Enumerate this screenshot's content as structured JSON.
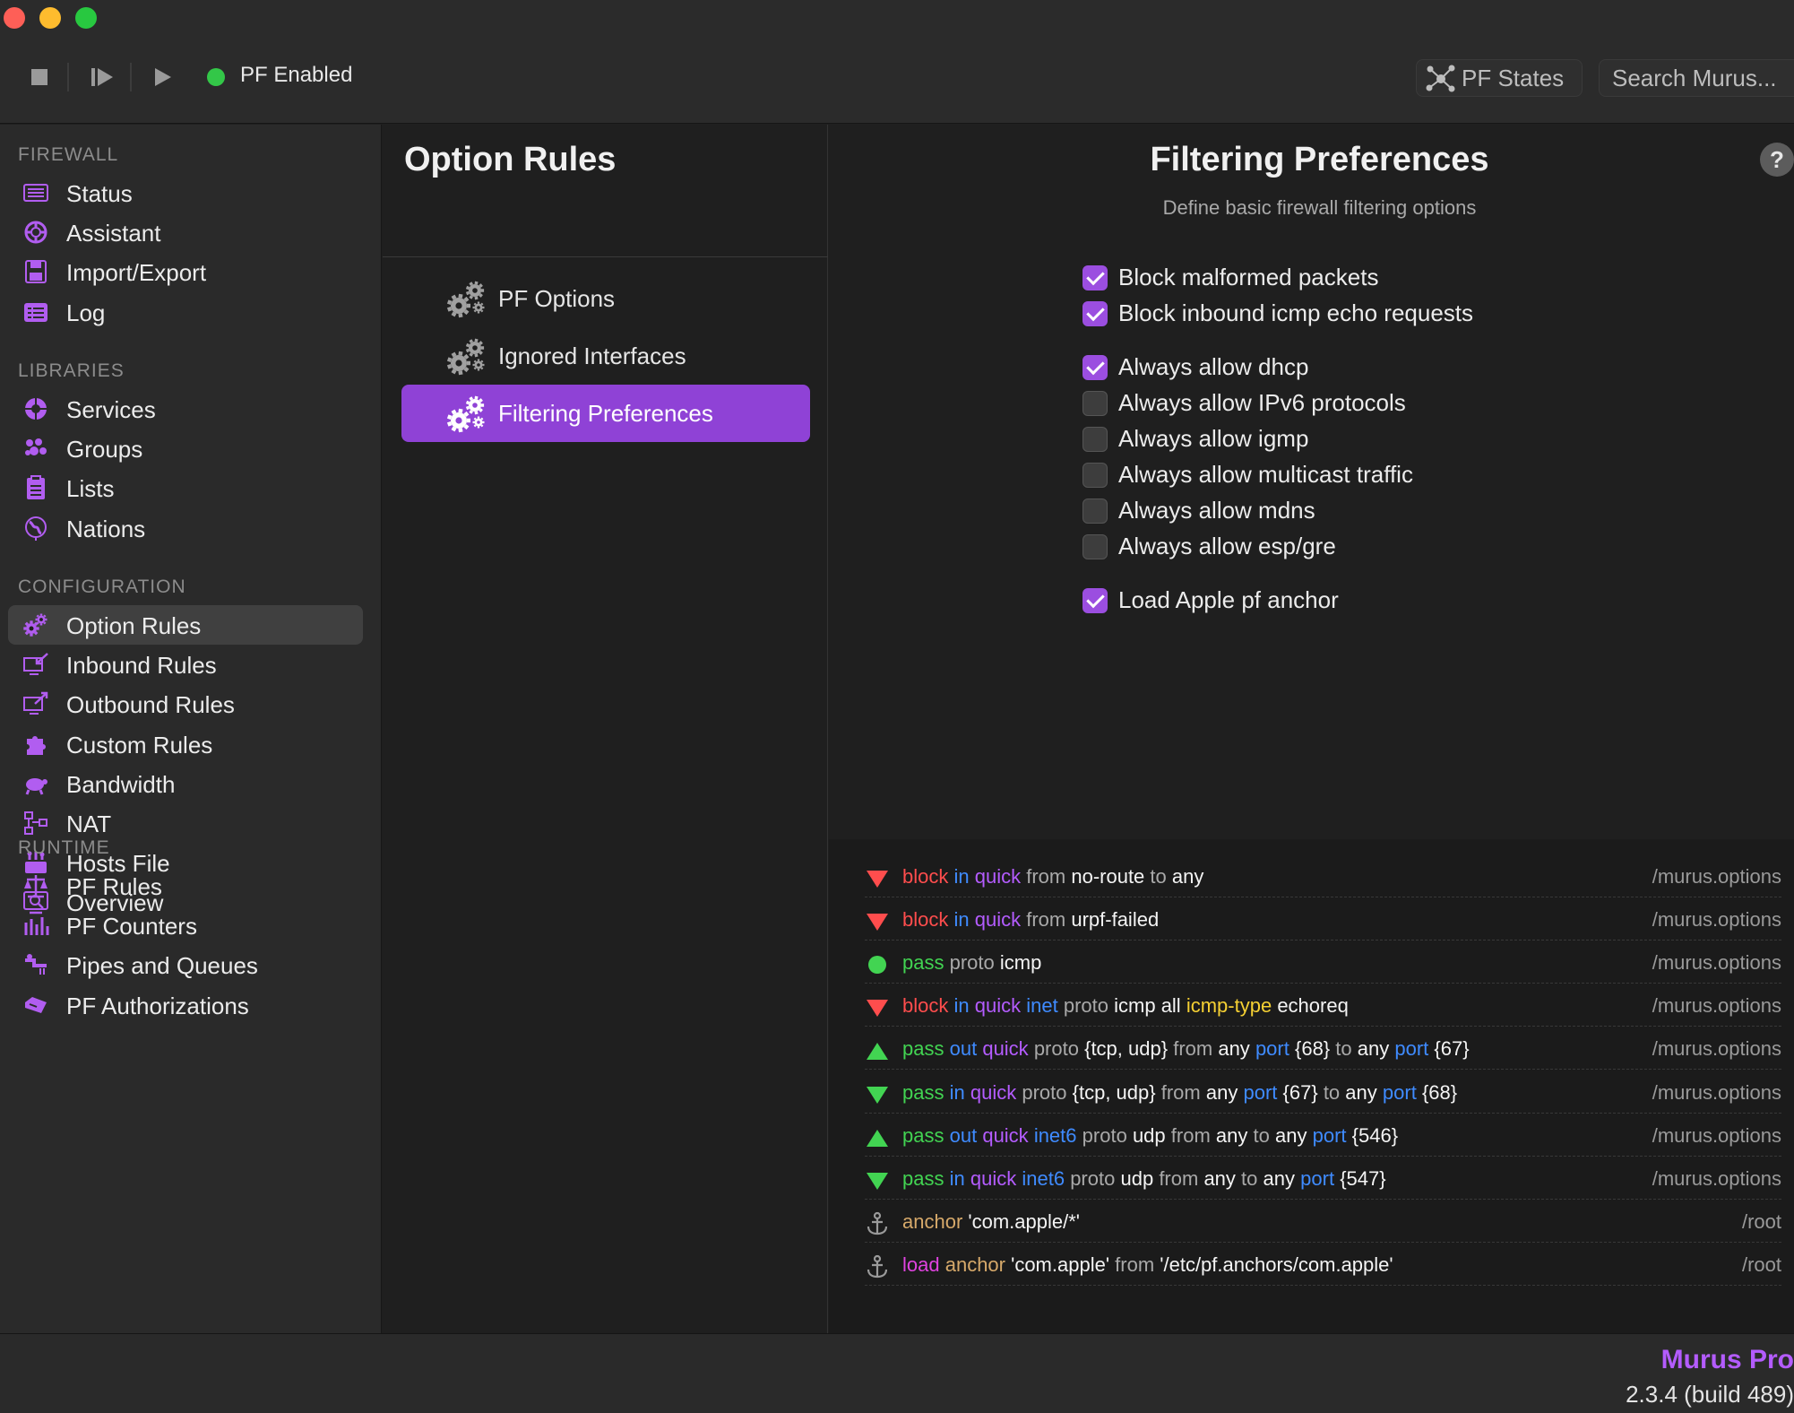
{
  "toolbar": {
    "status_text": "PF Enabled",
    "status_color": "#33c748",
    "pf_states_label": "PF States",
    "search_placeholder": "Search Murus..."
  },
  "sidebar": {
    "sections": [
      {
        "title": "FIREWALL",
        "items": [
          {
            "label": "Status",
            "icon": "status-icon"
          },
          {
            "label": "Assistant",
            "icon": "assistant-icon"
          },
          {
            "label": "Import/Export",
            "icon": "import-export-icon"
          },
          {
            "label": "Log",
            "icon": "log-icon"
          }
        ]
      },
      {
        "title": "LIBRARIES",
        "items": [
          {
            "label": "Services",
            "icon": "services-icon"
          },
          {
            "label": "Groups",
            "icon": "groups-icon"
          },
          {
            "label": "Lists",
            "icon": "lists-icon"
          },
          {
            "label": "Nations",
            "icon": "nations-icon"
          }
        ]
      },
      {
        "title": "CONFIGURATION",
        "items": [
          {
            "label": "Option Rules",
            "icon": "option-rules-icon",
            "active": true
          },
          {
            "label": "Inbound Rules",
            "icon": "inbound-rules-icon"
          },
          {
            "label": "Outbound Rules",
            "icon": "outbound-rules-icon"
          },
          {
            "label": "Custom Rules",
            "icon": "custom-rules-icon"
          },
          {
            "label": "Bandwidth",
            "icon": "bandwidth-icon"
          },
          {
            "label": "NAT",
            "icon": "nat-icon"
          },
          {
            "label": "Hosts File",
            "icon": "hosts-file-icon"
          },
          {
            "label": "Overview",
            "icon": "overview-icon"
          }
        ]
      },
      {
        "title": "RUNTIME",
        "items": [
          {
            "label": "PF Rules",
            "icon": "pf-rules-icon"
          },
          {
            "label": "PF Counters",
            "icon": "pf-counters-icon"
          },
          {
            "label": "Pipes and Queues",
            "icon": "pipes-queues-icon"
          },
          {
            "label": "PF Authorizations",
            "icon": "pf-authorizations-icon"
          }
        ]
      }
    ]
  },
  "middle": {
    "title": "Option Rules",
    "items": [
      {
        "label": "PF Options"
      },
      {
        "label": "Ignored Interfaces"
      },
      {
        "label": "Filtering Preferences",
        "active": true
      }
    ]
  },
  "main": {
    "title": "Filtering Preferences",
    "subtitle": "Define basic firewall filtering options",
    "help_label": "?",
    "options": [
      {
        "label": "Block malformed packets",
        "checked": true
      },
      {
        "label": "Block inbound icmp echo requests",
        "checked": true
      },
      {
        "label": "Always allow dhcp",
        "checked": true
      },
      {
        "label": "Always allow IPv6 protocols",
        "checked": false
      },
      {
        "label": "Always allow igmp",
        "checked": false
      },
      {
        "label": "Always allow multicast traffic",
        "checked": false
      },
      {
        "label": "Always allow mdns",
        "checked": false
      },
      {
        "label": "Always allow esp/gre",
        "checked": false
      },
      {
        "label": "Load Apple pf anchor",
        "checked": true
      }
    ]
  },
  "rules": [
    {
      "icon": "block-in",
      "source": "/murus.options",
      "tokens": [
        [
          "block",
          "k-block"
        ],
        [
          "in",
          "k-dir"
        ],
        [
          "quick",
          "k-quick"
        ],
        [
          "from",
          "k-kw"
        ],
        [
          "no-route",
          "k-val"
        ],
        [
          "to",
          "k-kw"
        ],
        [
          "any",
          "k-val"
        ]
      ]
    },
    {
      "icon": "block-in",
      "source": "/murus.options",
      "tokens": [
        [
          "block",
          "k-block"
        ],
        [
          "in",
          "k-dir"
        ],
        [
          "quick",
          "k-quick"
        ],
        [
          "from",
          "k-kw"
        ],
        [
          "urpf-failed",
          "k-val"
        ]
      ]
    },
    {
      "icon": "pass",
      "source": "/murus.options",
      "tokens": [
        [
          "pass",
          "k-pass"
        ],
        [
          "proto",
          "k-kw"
        ],
        [
          "icmp",
          "k-val"
        ]
      ]
    },
    {
      "icon": "block-in",
      "source": "/murus.options",
      "tokens": [
        [
          "block",
          "k-block"
        ],
        [
          "in",
          "k-dir"
        ],
        [
          "quick",
          "k-quick"
        ],
        [
          "inet",
          "k-fam"
        ],
        [
          "proto",
          "k-kw"
        ],
        [
          "icmp",
          "k-val"
        ],
        [
          "all",
          "k-val"
        ],
        [
          "icmp-type",
          "k-icmptype"
        ],
        [
          "echoreq",
          "k-val"
        ]
      ]
    },
    {
      "icon": "pass-out",
      "source": "/murus.options",
      "tokens": [
        [
          "pass",
          "k-pass"
        ],
        [
          "out",
          "k-dir"
        ],
        [
          "quick",
          "k-quick"
        ],
        [
          "proto",
          "k-kw"
        ],
        [
          "{tcp, udp}",
          "k-val"
        ],
        [
          "from",
          "k-kw"
        ],
        [
          "any",
          "k-val"
        ],
        [
          "port",
          "k-dir"
        ],
        [
          "{68}",
          "k-val"
        ],
        [
          "to",
          "k-kw"
        ],
        [
          "any",
          "k-val"
        ],
        [
          "port",
          "k-dir"
        ],
        [
          "{67}",
          "k-val"
        ]
      ]
    },
    {
      "icon": "pass-in",
      "source": "/murus.options",
      "tokens": [
        [
          "pass",
          "k-pass"
        ],
        [
          "in",
          "k-dir"
        ],
        [
          "quick",
          "k-quick"
        ],
        [
          "proto",
          "k-kw"
        ],
        [
          "{tcp, udp}",
          "k-val"
        ],
        [
          "from",
          "k-kw"
        ],
        [
          "any",
          "k-val"
        ],
        [
          "port",
          "k-dir"
        ],
        [
          "{67}",
          "k-val"
        ],
        [
          "to",
          "k-kw"
        ],
        [
          "any",
          "k-val"
        ],
        [
          "port",
          "k-dir"
        ],
        [
          "{68}",
          "k-val"
        ]
      ]
    },
    {
      "icon": "pass-out",
      "source": "/murus.options",
      "tokens": [
        [
          "pass",
          "k-pass"
        ],
        [
          "out",
          "k-dir"
        ],
        [
          "quick",
          "k-quick"
        ],
        [
          "inet6",
          "k-fam"
        ],
        [
          "proto",
          "k-kw"
        ],
        [
          "udp",
          "k-val"
        ],
        [
          "from",
          "k-kw"
        ],
        [
          "any",
          "k-val"
        ],
        [
          "to",
          "k-kw"
        ],
        [
          "any",
          "k-val"
        ],
        [
          "port",
          "k-dir"
        ],
        [
          "{546}",
          "k-val"
        ]
      ]
    },
    {
      "icon": "pass-in",
      "source": "/murus.options",
      "tokens": [
        [
          "pass",
          "k-pass"
        ],
        [
          "in",
          "k-dir"
        ],
        [
          "quick",
          "k-quick"
        ],
        [
          "inet6",
          "k-fam"
        ],
        [
          "proto",
          "k-kw"
        ],
        [
          "udp",
          "k-val"
        ],
        [
          "from",
          "k-kw"
        ],
        [
          "any",
          "k-val"
        ],
        [
          "to",
          "k-kw"
        ],
        [
          "any",
          "k-val"
        ],
        [
          "port",
          "k-dir"
        ],
        [
          "{547}",
          "k-val"
        ]
      ]
    },
    {
      "icon": "anchor",
      "source": "/root",
      "tokens": [
        [
          "anchor",
          "k-anchor"
        ],
        [
          "'com.apple/*'",
          "k-val"
        ]
      ]
    },
    {
      "icon": "anchor",
      "source": "/root",
      "tokens": [
        [
          "load",
          "k-load"
        ],
        [
          "anchor",
          "k-anchor"
        ],
        [
          "'com.apple'",
          "k-val"
        ],
        [
          "from",
          "k-kw"
        ],
        [
          "'/etc/pf.anchors/com.apple'",
          "k-val"
        ]
      ]
    }
  ],
  "footer": {
    "brand": "Murus Pro",
    "version": "2.3.4 (build 489)"
  },
  "colors": {
    "accent": "#9b4ee0",
    "selection": "#8f42d6",
    "block": "#ff4d4d",
    "pass": "#42d452"
  }
}
